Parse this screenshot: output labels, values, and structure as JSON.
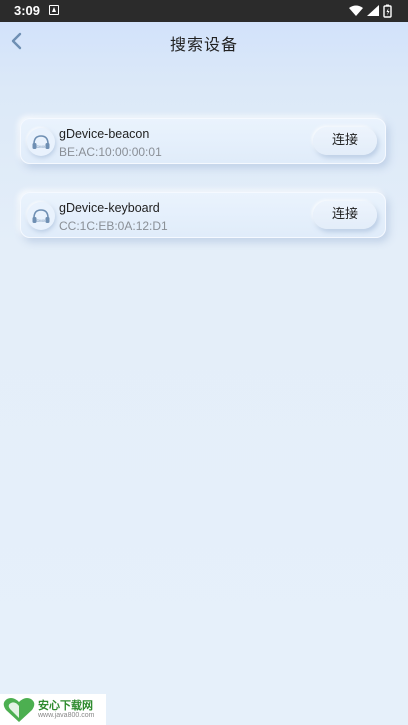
{
  "status_bar": {
    "time": "3:09",
    "icons": [
      "notification-icon",
      "wifi-icon",
      "signal-icon",
      "battery-icon"
    ]
  },
  "header": {
    "back_icon": "chevron-left-icon",
    "title": "搜索设备"
  },
  "devices": [
    {
      "name": "gDevice-beacon",
      "mac": "BE:AC:10:00:00:01",
      "icon": "headphones-icon",
      "action_label": "连接"
    },
    {
      "name": "gDevice-keyboard",
      "mac": "CC:1C:EB:0A:12:D1",
      "icon": "headphones-icon",
      "action_label": "连接"
    }
  ],
  "watermark": {
    "title": "安心下载网",
    "url": "www.java800.com"
  },
  "colors": {
    "accent": "#6f8fb3",
    "status_bar": "#2b2b2b",
    "text_primary": "#222222",
    "text_secondary": "#8a8f96"
  }
}
